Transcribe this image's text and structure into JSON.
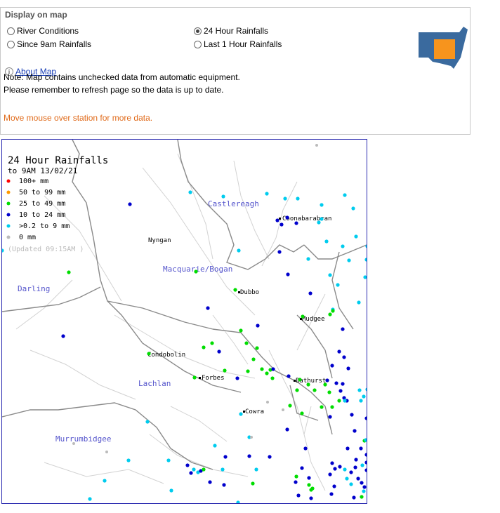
{
  "panel": {
    "legend": "Display on map",
    "options": [
      {
        "label": "River Conditions",
        "checked": false
      },
      {
        "label": "Since 9am Rainfalls",
        "checked": false
      },
      {
        "label": "24 Hour Rainfalls",
        "checked": true
      },
      {
        "label": "Last 1 Hour Rainfalls",
        "checked": false
      }
    ],
    "about_link": "About Map",
    "note_line1": "Note: Map contains unchecked data from automatic equipment.",
    "note_line2": "Please remember to refresh page so the data is up to date.",
    "hover_hint": "Move mouse over station for more data."
  },
  "map": {
    "title": "24 Hour Rainfalls",
    "subtitle": "to 9AM 13/02/21",
    "updated": "(Updated 09:15AM )",
    "legend": [
      {
        "label": "100+ mm",
        "color": "#ff0000"
      },
      {
        "label": "50  to 99 mm",
        "color": "#ff9900"
      },
      {
        "label": "25  to 49 mm",
        "color": "#00dd00"
      },
      {
        "label": "10  to 24 mm",
        "color": "#0000cc"
      },
      {
        "label": ">0.2 to 9 mm",
        "color": "#00ccee"
      },
      {
        "label": "0 mm",
        "color": "#bbbbbb"
      }
    ],
    "basins": [
      "Castlereagh",
      "Macquarie/Bogan",
      "Darling",
      "Lachlan",
      "Murrumbidgee"
    ],
    "towns": [
      "Coonabarabran",
      "Nyngan",
      "Dubbo",
      "Mudgee",
      "Condobolin",
      "Forbes",
      "Bathurst",
      "Cowra"
    ],
    "colors": {
      "basin_label": "#5555cc",
      "border": "#2b2bb0",
      "nsw_fill": "#3a6a9e",
      "nsw_highlight": "#f7941d"
    }
  }
}
